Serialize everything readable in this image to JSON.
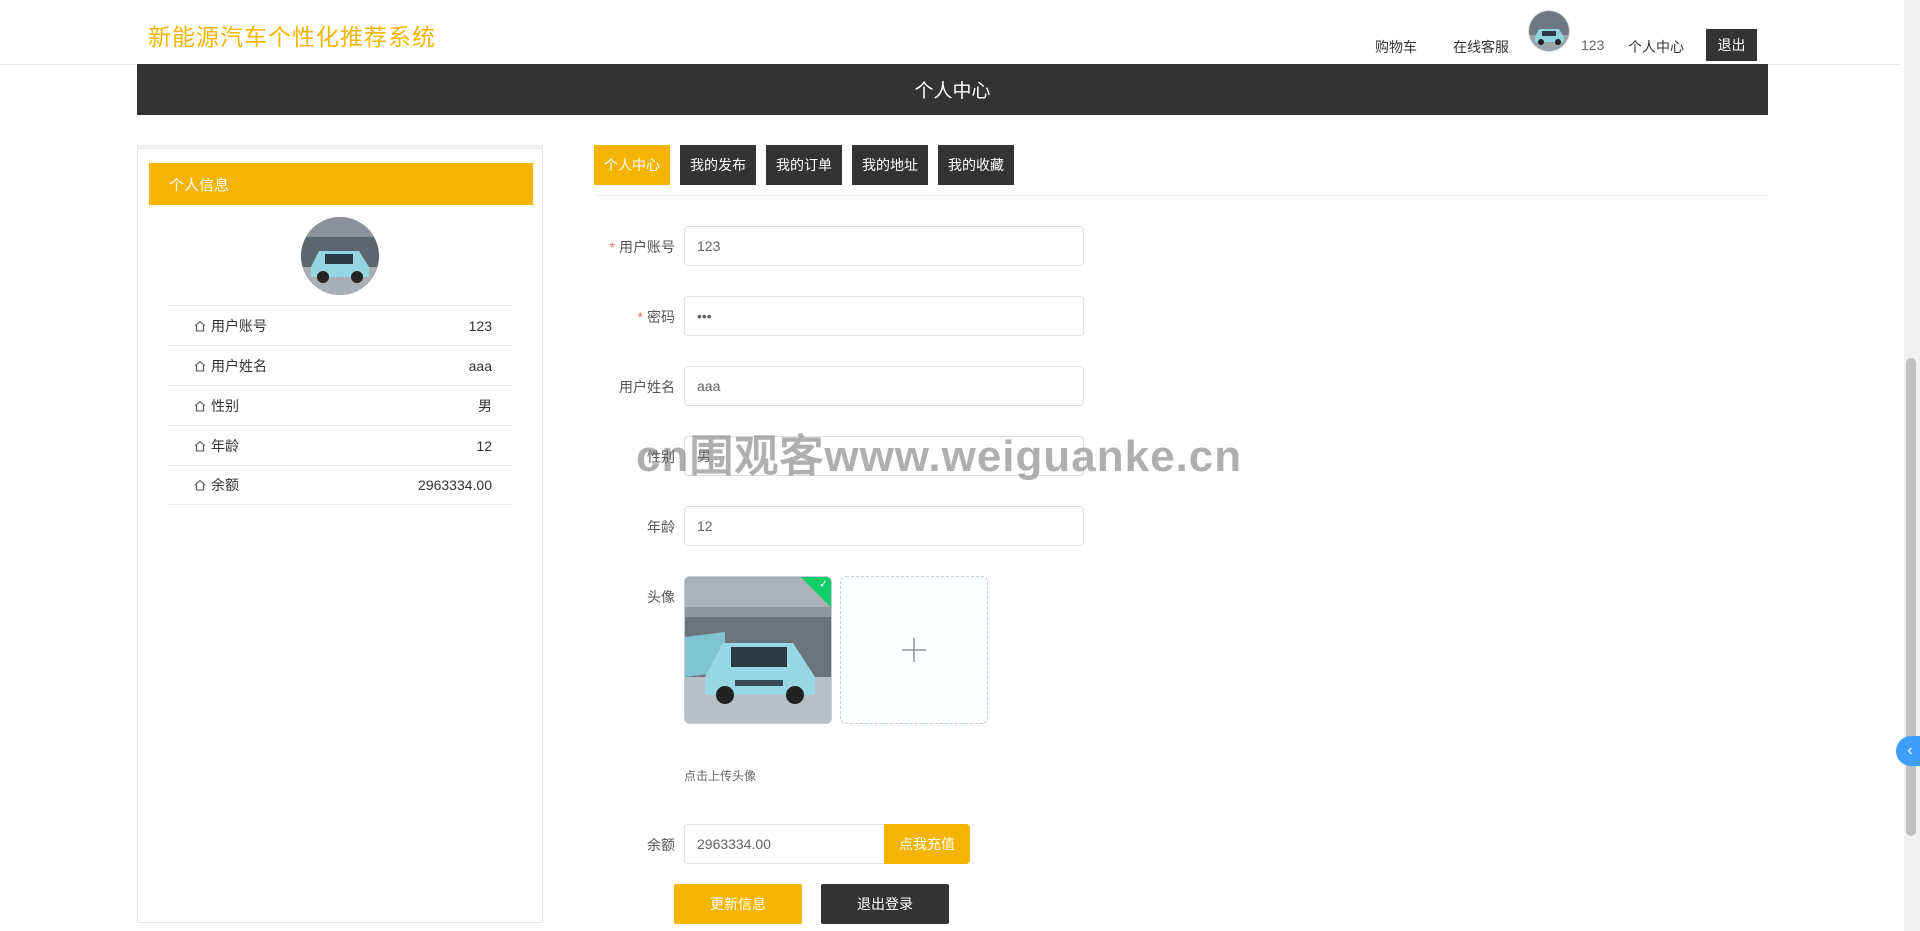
{
  "header": {
    "site_title": "新能源汽车个性化推荐系统",
    "nav": {
      "cart": "购物车",
      "service": "在线客服",
      "username": "123",
      "profile": "个人中心",
      "logout": "退出"
    }
  },
  "banner": {
    "title": "个人中心"
  },
  "profile_panel": {
    "heading": "个人信息",
    "rows": [
      {
        "label": "用户账号",
        "value": "123"
      },
      {
        "label": "用户姓名",
        "value": "aaa"
      },
      {
        "label": "性别",
        "value": "男"
      },
      {
        "label": "年龄",
        "value": "12"
      },
      {
        "label": "余额",
        "value": "2963334.00"
      }
    ]
  },
  "tabs": [
    "个人中心",
    "我的发布",
    "我的订单",
    "我的地址",
    "我的收藏"
  ],
  "active_tab": "个人中心",
  "form": {
    "account": {
      "label": "用户账号",
      "value": "123",
      "required": true
    },
    "password": {
      "label": "密码",
      "value": "•••",
      "required": true
    },
    "name": {
      "label": "用户姓名",
      "value": "aaa"
    },
    "gender": {
      "label": "性别",
      "value": "男"
    },
    "age": {
      "label": "年龄",
      "value": "12"
    },
    "avatar": {
      "label": "头像",
      "tip": "点击上传头像"
    },
    "balance": {
      "label": "余额",
      "value": "2963334.00",
      "recharge": "点我充值"
    },
    "update_button": "更新信息",
    "logout_button": "退出登录"
  },
  "watermark": "cn围观客www.weiguanke.cn",
  "colors": {
    "accent": "#f5b400",
    "dark": "#333333",
    "success": "#13ce66",
    "toggle": "#409eff"
  }
}
